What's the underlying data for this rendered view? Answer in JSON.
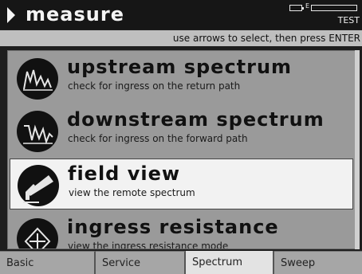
{
  "header": {
    "title": "measure",
    "battery_label": "E",
    "mode_label": "TEST"
  },
  "instruction": "use arrows to select, then press ENTER",
  "menu": {
    "items": [
      {
        "title": "upstream spectrum",
        "subtitle": "check for ingress on the return path",
        "icon": "upstream-spectrum-icon",
        "selected": false
      },
      {
        "title": "downstream spectrum",
        "subtitle": "check for ingress on the forward path",
        "icon": "downstream-spectrum-icon",
        "selected": false
      },
      {
        "title": "field view",
        "subtitle": "view the remote spectrum",
        "icon": "field-view-icon",
        "selected": true
      },
      {
        "title": "ingress resistance",
        "subtitle": "view the ingress resistance mode",
        "icon": "ingress-resistance-icon",
        "selected": false
      }
    ]
  },
  "tabs": [
    {
      "label": "Basic",
      "active": false
    },
    {
      "label": "Service",
      "active": false
    },
    {
      "label": "Spectrum",
      "active": true
    },
    {
      "label": "Sweep",
      "active": false
    }
  ],
  "colors": {
    "background": "#1e1e1e",
    "panel": "#9a9a9a",
    "selected": "#f2f2f2",
    "active_tab": "#e3e3e3",
    "tab": "#a6a6a6"
  }
}
